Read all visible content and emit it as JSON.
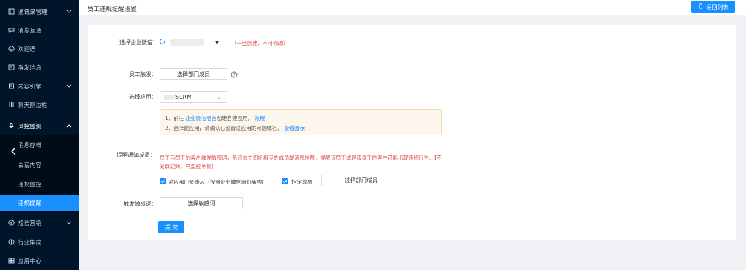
{
  "sidebar": {
    "items": [
      {
        "label": "通讯录管理",
        "icon": "contacts-icon",
        "arrow": "down"
      },
      {
        "label": "消息互通",
        "icon": "message-icon"
      },
      {
        "label": "欢迎语",
        "icon": "smile-icon"
      },
      {
        "label": "群发消息",
        "icon": "broadcast-icon"
      },
      {
        "label": "内容引擎",
        "icon": "content-icon",
        "arrow": "down"
      },
      {
        "label": "聊天侧边栏",
        "icon": "sidebar-icon"
      },
      {
        "label": "风控监测",
        "icon": "microphone-icon",
        "arrow": "up"
      },
      {
        "label": "短信营销",
        "icon": "sms-icon",
        "arrow": "down"
      },
      {
        "label": "行业集成",
        "icon": "integration-icon"
      },
      {
        "label": "应用中心",
        "icon": "apps-icon"
      }
    ],
    "submenu": [
      {
        "label": "消息存档"
      },
      {
        "label": "会话内容"
      },
      {
        "label": "违规监控"
      },
      {
        "label": "违规提醒",
        "active": true
      }
    ]
  },
  "header": {
    "title": "员工违规提醒设置",
    "back_label": "返回列表"
  },
  "form": {
    "corp_wechat_label": "选择企业微信：",
    "corp_wechat_note": "（一旦创建，不可修改）",
    "employee_trigger_label": "员工触发：",
    "select_dept_member": "选择部门成员",
    "select_app_label": "选择应用：",
    "select_app_value": "SCRM",
    "hint": {
      "line1_prefix": "1、前往 ",
      "line1_link": "企业微信后台",
      "line1_mid": "创建自建应用。 ",
      "line1_link2": "教程",
      "line2_prefix": "2、选择此应用，请确认已设置过应用的可信域名。 ",
      "line2_link": "查看图示"
    },
    "notify_label": "提醒通知成员：",
    "notify_warning": "员工与员工的客户触发敏感词，系统会立即给相应的成员发消息提醒，提醒该员工或是该员工的客户可能出现违规行为。【不对群起效，只监控单聊】",
    "checkbox_dept_head": "对应部门负责人（按照企业微信组织架构）",
    "checkbox_specify": "指定成员",
    "select_dept_member_2": "选择部门成员",
    "sensitive_label": "触发敏感词：",
    "select_sensitive": "选择敏感词",
    "submit": "提 交"
  },
  "colors": {
    "sidebar_bg": "#001529",
    "accent": "#1890ff",
    "warning": "#e0514b"
  }
}
